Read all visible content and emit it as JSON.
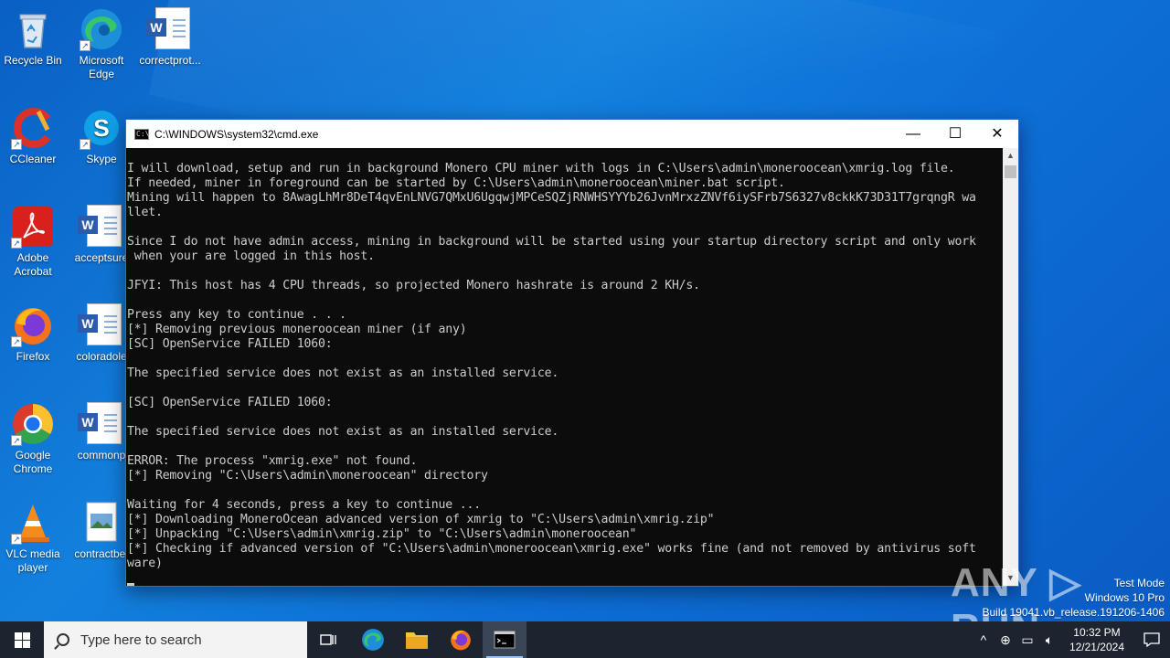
{
  "desktop": {
    "icons": [
      {
        "label": "Recycle Bin",
        "icon": "recycle-bin-icon"
      },
      {
        "label": "Microsoft Edge",
        "icon": "edge-icon"
      },
      {
        "label": "correctprot...",
        "icon": "word-doc-icon"
      },
      {
        "label": "CCleaner",
        "icon": "ccleaner-icon"
      },
      {
        "label": "Skype",
        "icon": "skype-icon"
      },
      {
        "label": "Adobe Acrobat",
        "icon": "acrobat-icon"
      },
      {
        "label": "acceptsure",
        "icon": "word-doc-icon"
      },
      {
        "label": "Firefox",
        "icon": "firefox-icon"
      },
      {
        "label": "coloradole",
        "icon": "word-doc-icon"
      },
      {
        "label": "Google Chrome",
        "icon": "chrome-icon"
      },
      {
        "label": "commonp",
        "icon": "word-doc-icon"
      },
      {
        "label": "VLC media player",
        "icon": "vlc-icon"
      },
      {
        "label": "contractbet",
        "icon": "image-file-icon"
      }
    ]
  },
  "cmd_window": {
    "title": "C:\\WINDOWS\\system32\\cmd.exe",
    "controls": {
      "minimize": "—",
      "maximize": "☐",
      "close": "✕"
    },
    "lines": [
      "I will download, setup and run in background Monero CPU miner with logs in C:\\Users\\admin\\moneroocean\\xmrig.log file.",
      "If needed, miner in foreground can be started by C:\\Users\\admin\\moneroocean\\miner.bat script.",
      "Mining will happen to 8AwagLhMr8DeT4qvEnLNVG7QMxU6UgqwjMPCeSQZjRNWHSYYYb26JvnMrxzZNVf6iySFrb7S6327v8ckkK73D31T7grqngR wa",
      "llet.",
      "",
      "Since I do not have admin access, mining in background will be started using your startup directory script and only work",
      " when your are logged in this host.",
      "",
      "JFYI: This host has 4 CPU threads, so projected Monero hashrate is around 2 KH/s.",
      "",
      "Press any key to continue . . .",
      "[*] Removing previous moneroocean miner (if any)",
      "[SC] OpenService FAILED 1060:",
      "",
      "The specified service does not exist as an installed service.",
      "",
      "[SC] OpenService FAILED 1060:",
      "",
      "The specified service does not exist as an installed service.",
      "",
      "ERROR: The process \"xmrig.exe\" not found.",
      "[*] Removing \"C:\\Users\\admin\\moneroocean\" directory",
      "",
      "Waiting for 4 seconds, press a key to continue ...",
      "[*] Downloading MoneroOcean advanced version of xmrig to \"C:\\Users\\admin\\xmrig.zip\"",
      "[*] Unpacking \"C:\\Users\\admin\\xmrig.zip\" to \"C:\\Users\\admin\\moneroocean\"",
      "[*] Checking if advanced version of \"C:\\Users\\admin\\moneroocean\\xmrig.exe\" works fine (and not removed by antivirus soft",
      "ware)"
    ]
  },
  "watermark": "ANY ▷ RUN",
  "system_info": {
    "line1": "Test Mode",
    "line2": "Windows 10 Pro",
    "line3": "Build 19041.vb_release.191206-1406"
  },
  "taskbar": {
    "search_placeholder": "Type here to search",
    "pinned": [
      "task-view-icon",
      "edge-icon",
      "file-explorer-icon",
      "firefox-icon",
      "cmd-icon"
    ],
    "clock_time": "10:32 PM",
    "clock_date": "12/21/2024",
    "colors": {
      "taskbar": "#1c2430",
      "desktop": "#0d6fd6"
    }
  }
}
